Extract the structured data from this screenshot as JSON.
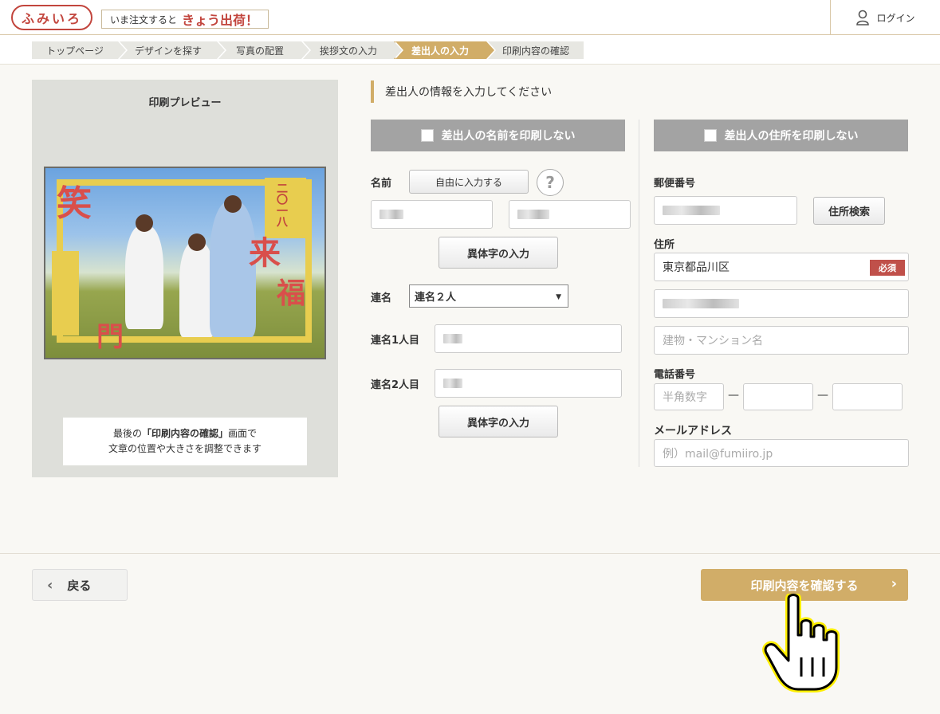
{
  "header": {
    "logo_text": "ふみいろ",
    "promo_pre": "いま注文すると",
    "promo_big": "きょう出荷！",
    "login_label": "ログイン"
  },
  "steps": [
    "トップページ",
    "デザインを探す",
    "写真の配置",
    "挨拶文の入力",
    "差出人の入力",
    "印刷内容の確認"
  ],
  "active_step": "差出人の入力",
  "preview": {
    "title": "印刷プレビュー",
    "card_kanji": [
      "笑",
      "来",
      "福",
      "門"
    ],
    "card_year_text": "二〇一八",
    "note_line1_pre": "最後の",
    "note_line1_bold": "「印刷内容の確認」",
    "note_line1_post": "画面で",
    "note_line2": "文章の位置や大きさを調整できます"
  },
  "form": {
    "section_title": "差出人の情報を入力してください",
    "no_name_print": "差出人の名前を印刷しない",
    "no_address_print": "差出人の住所を印刷しない",
    "name_label": "名前",
    "free_input_button": "自由に入力する",
    "help_label": "?",
    "variant_button": "異体字の入力",
    "joint_label": "連名",
    "joint_value": "連名２人",
    "joint1_label": "連名1人目",
    "joint2_label": "連名2人目",
    "postal_label": "郵便番号",
    "address_search_button": "住所検索",
    "address_label": "住所",
    "address_value": "東京都品川区",
    "required_badge": "必須",
    "building_placeholder": "建物・マンション名",
    "phone_label": "電話番号",
    "phone_placeholder": "半角数字",
    "phone_dash": "—",
    "email_label": "メールアドレス",
    "email_placeholder": "例）mail@fumiiro.jp"
  },
  "footer": {
    "back_label": "戻る",
    "confirm_label": "印刷内容を確認する"
  },
  "colors": {
    "accent": "#d1ad68",
    "brand_red": "#c2453d",
    "gray_button": "#a3a3a3"
  }
}
